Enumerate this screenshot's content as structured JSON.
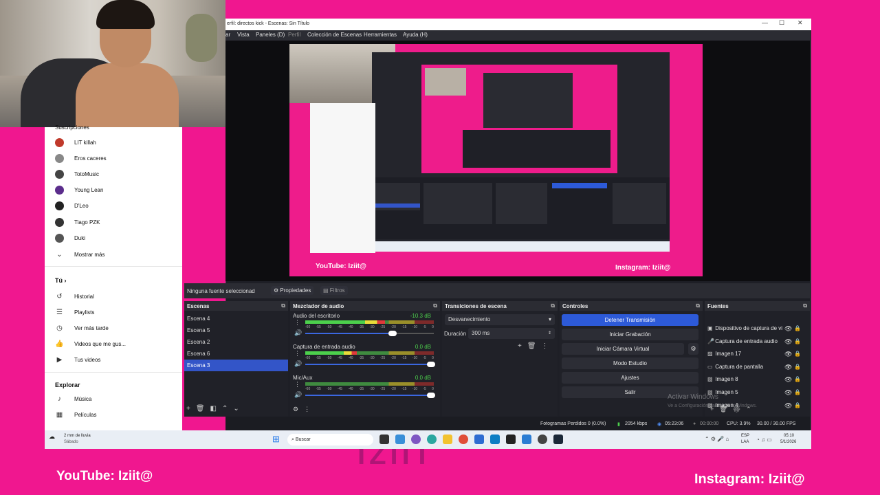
{
  "obs": {
    "title": "erfil: directos kick - Escenas: Sin Título",
    "menu": [
      "ar",
      "Vista",
      "Paneles (D)",
      "Perfil",
      "Colección de Escenas",
      "Herramientas",
      "Ayuda (H)"
    ],
    "no_source": "Ninguna fuente seleccionad",
    "properties": "Propiedades",
    "filters": "Filtros",
    "docks": {
      "scenes_title": "Escenas",
      "mixer_title": "Mezclador de audio",
      "transitions_title": "Transiciones de escena",
      "controls_title": "Controles",
      "sources_title": "Fuentes"
    },
    "scenes": [
      "Escena 4",
      "Escena 5",
      "Escena 2",
      "Escena 6",
      "Escena 3"
    ],
    "selected_scene": "Escena 3",
    "mixer": [
      {
        "name": "Audio del escritorio",
        "db": "-10.3 dB",
        "level": 0.62,
        "volume": 0.7
      },
      {
        "name": "Captura de entrada audio",
        "db": "0.0 dB",
        "level": 0.4,
        "volume": 1.0
      },
      {
        "name": "Mic/Aux",
        "db": "0.0 dB",
        "level": 0.0,
        "volume": 1.0
      }
    ],
    "meter_ticks": [
      "-60",
      "-55",
      "-50",
      "-45",
      "-40",
      "-35",
      "-30",
      "-25",
      "-20",
      "-15",
      "-10",
      "-5",
      "0"
    ],
    "transition": {
      "type": "Desvanecimiento",
      "duration_label": "Duración",
      "duration": "300 ms"
    },
    "controls": {
      "stop_stream": "Detener Transmisión",
      "start_record": "Iniciar Grabación",
      "start_vcam": "Iniciar Cámara Virtual",
      "studio_mode": "Modo Estudio",
      "settings": "Ajustes",
      "exit": "Salir"
    },
    "sources": [
      {
        "name": "Dispositivo de captura de vi",
        "icon": "camera-icon"
      },
      {
        "name": "Captura de entrada audio",
        "icon": "mic-icon"
      },
      {
        "name": "Imagen 17",
        "icon": "image-icon"
      },
      {
        "name": "Captura de pantalla",
        "icon": "monitor-icon"
      },
      {
        "name": "Imagen 8",
        "icon": "image-icon"
      },
      {
        "name": "Imagen 5",
        "icon": "image-icon"
      },
      {
        "name": "Imagen 4",
        "icon": "image-icon"
      }
    ],
    "status": {
      "dropped": "Fotogramas Perdidos 0 (0.0%)",
      "kbps": "2054 kbps",
      "live_time": "05:23:06",
      "rec_time": "00:00:00",
      "cpu": "CPU: 3.9%",
      "fps": "30.00 / 30.00 FPS"
    },
    "activate_windows": "Activar Windows",
    "activate_windows_sub": "Ve a Configuración para activar Windows."
  },
  "youtube": {
    "subs_header": "Suscripciones",
    "channels": [
      "LIT killah",
      "Eros caceres",
      "TotoMusic",
      "Young Lean",
      "D'Leo",
      "Tiago PZK",
      "Duki"
    ],
    "channel_colors": [
      "#c0392b",
      "#888888",
      "#444444",
      "#5b2d8c",
      "#222222",
      "#333333",
      "#555555"
    ],
    "show_more": "Mostrar más",
    "you_header": "Tú",
    "you_items": [
      "Historial",
      "Playlists",
      "Ver más tarde",
      "Videos que me gus...",
      "Tus videos"
    ],
    "explore_header": "Explorar",
    "explore_items": [
      "Música",
      "Películas"
    ]
  },
  "overlay": {
    "youtube": "YouTube: Iziit@",
    "instagram": "Instagram: Iziit@",
    "watermark": "IZIIT"
  },
  "taskbar": {
    "weather": "2 mm de lluvia",
    "weather_day": "Sábado",
    "search": "Buscar",
    "lang1": "ESP",
    "lang2": "LAA",
    "time": "05:10",
    "date": "5/1/2026"
  }
}
